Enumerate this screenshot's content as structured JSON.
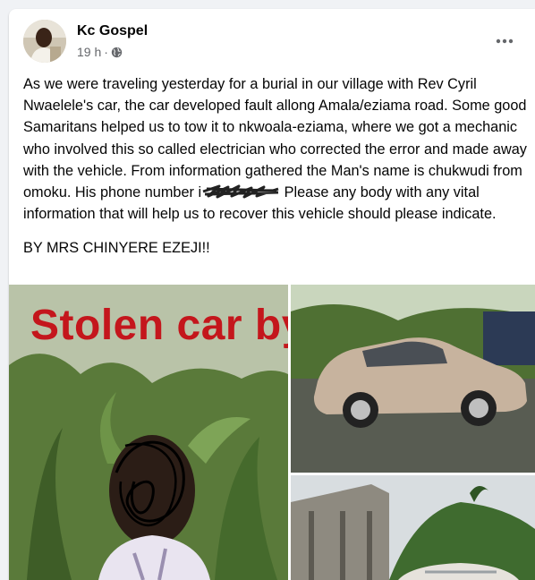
{
  "post": {
    "author": "Kc Gospel",
    "time": "19 h",
    "separator": "·",
    "visibility_icon": "globe-icon",
    "more_icon": "more-options-icon",
    "body_1a": "As we were traveling yesterday for a burial in our village with Rev Cyril Nwaelele's car, the car developed fault allong Amala/eziama road. Some good Samaritans helped us to tow it to nkwoala-eziama, where we got a mechanic who involved this so called electrician who corrected the error and made away with the vehicle. From information gathered the Man's name is chukwudi from omoku. His phone number i",
    "body_1b": " Please any body with any vital information that will help us to recover this vehicle should please indicate.",
    "body_2": "BY MRS CHINYERE EZEJI!!"
  },
  "photos": {
    "left_overlay_text": "Stolen car by"
  },
  "colors": {
    "background": "#f0f2f5",
    "card": "#ffffff",
    "text": "#050505",
    "secondary_text": "#65676b",
    "overlay_red": "#c4161c"
  }
}
